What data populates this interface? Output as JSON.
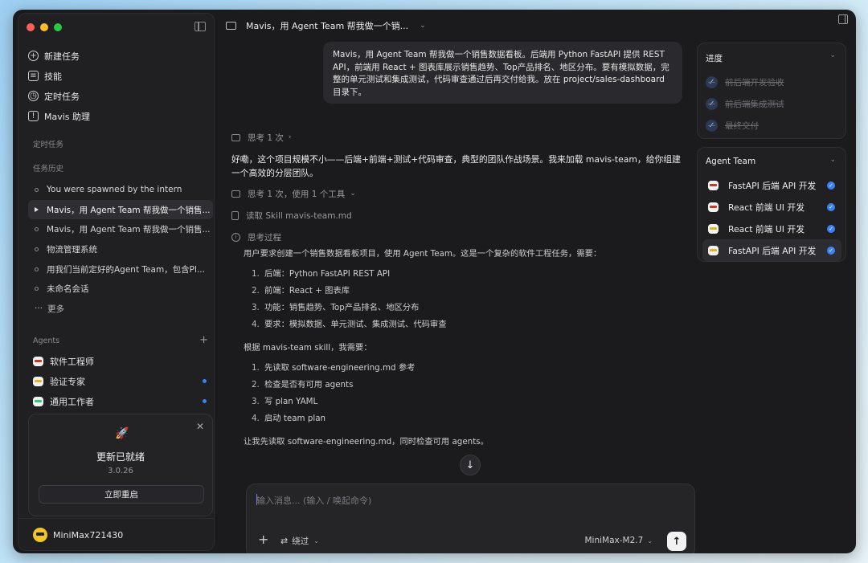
{
  "sidebar": {
    "nav": [
      {
        "label": "新建任务",
        "icon": "plus-circle-icon"
      },
      {
        "label": "技能",
        "icon": "clipboard-icon"
      },
      {
        "label": "定时任务",
        "icon": "alarm-clock-icon"
      },
      {
        "label": "Mavis 助理",
        "icon": "assistant-icon"
      }
    ],
    "scheduled_label": "定时任务",
    "history_label": "任务历史",
    "history": [
      "You were spawned by the intern",
      "Mavis，用 Agent Team 帮我做一个销售...",
      "Mavis，用 Agent Team 帮我做一个销售...",
      "物流管理系统",
      "用我们当前定好的Agent Team，包含Pl...",
      "未命名会话"
    ],
    "more_label": "更多",
    "agents_label": "Agents",
    "agents": [
      {
        "label": "软件工程师",
        "dot": false
      },
      {
        "label": "验证专家",
        "dot": true
      },
      {
        "label": "通用工作者",
        "dot": true
      }
    ],
    "update": {
      "title": "更新已就绪",
      "version": "3.0.26",
      "button": "立即重启",
      "close": "✕"
    },
    "user": "MiniMax721430"
  },
  "header": {
    "title": "Mavis，用 Agent Team 帮我做一个销..."
  },
  "chat": {
    "user_message": "Mavis，用 Agent Team 帮我做一个销售数据看板。后端用 Python FastAPI 提供 REST API，前端用 React + 图表库展示销售趋势、Top产品排名、地区分布。要有模拟数据，完整的单元测试和集成测试，代码审查通过后再交付给我。放在 project/sales-dashboard 目录下。",
    "think1": "思考 1 次",
    "answer": "好嘞，这个项目规模不小——后端+前端+测试+代码审查，典型的团队作战场景。我来加载 mavis-team，给你组建一个高效的分层团队。",
    "think2": "思考 1 次，使用 1 个工具",
    "tool": "读取 Skill mavis-team.md",
    "process_label": "思考过程",
    "reasoning_intro": "用户要求创建一个销售数据看板项目，使用 Agent Team。这是一个复杂的软件工程任务，需要：",
    "reasoning_list1": [
      "后端：Python FastAPI REST API",
      "前端：React + 图表库",
      "功能：销售趋势、Top产品排名、地区分布",
      "要求：模拟数据、单元测试、集成测试、代码审查"
    ],
    "reasoning_mid": "根据 mavis-team skill，我需要：",
    "reasoning_list2": [
      "先读取 software-engineering.md 参考",
      "检查是否有可用 agents",
      "写 plan YAML",
      "启动 team plan"
    ],
    "reasoning_tail": "让我先读取 software-engineering.md，同时检查可用 agents。"
  },
  "composer": {
    "placeholder": "输入消息... (输入 / 唤起命令)",
    "mode": "绕过",
    "model": "MiniMax-M2.7"
  },
  "progress": {
    "title": "进度",
    "items": [
      "前后端开发验收",
      "前后端集成测试",
      "最终交付"
    ]
  },
  "team": {
    "title": "Agent Team",
    "items": [
      {
        "label": "FastAPI 后端 API 开发",
        "color": "red"
      },
      {
        "label": "React 前端 UI 开发",
        "color": "red"
      },
      {
        "label": "React 前端 UI 开发",
        "color": "yellow"
      },
      {
        "label": "FastAPI 后端 API 开发",
        "color": "yellow"
      }
    ]
  },
  "colors": {
    "window_bg": "#1b1b1d",
    "accent": "#3b82f6"
  }
}
